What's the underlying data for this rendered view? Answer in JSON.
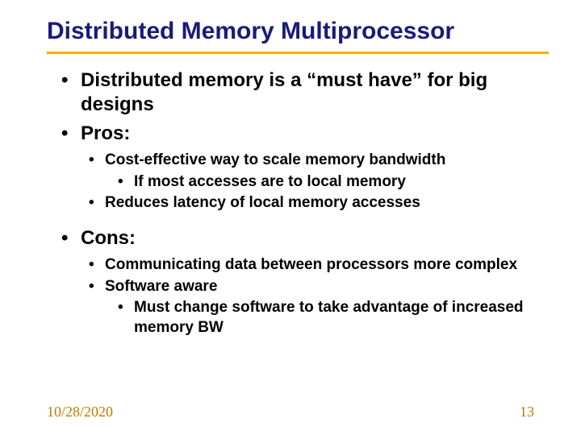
{
  "title": "Distributed Memory Multiprocessor",
  "bullets": {
    "intro": "Distributed memory is a “must have” for big designs",
    "pros_label": "Pros:",
    "pros": {
      "p1": "Cost-effective way to scale memory bandwidth",
      "p1a": "If most accesses are to local memory",
      "p2": "Reduces latency of local memory accesses"
    },
    "cons_label": "Cons:",
    "cons": {
      "c1": "Communicating data between processors more complex",
      "c2": "Software aware",
      "c2a": "Must change software to take advantage of increased memory BW"
    }
  },
  "footer": {
    "date": "10/28/2020",
    "page": "13"
  }
}
